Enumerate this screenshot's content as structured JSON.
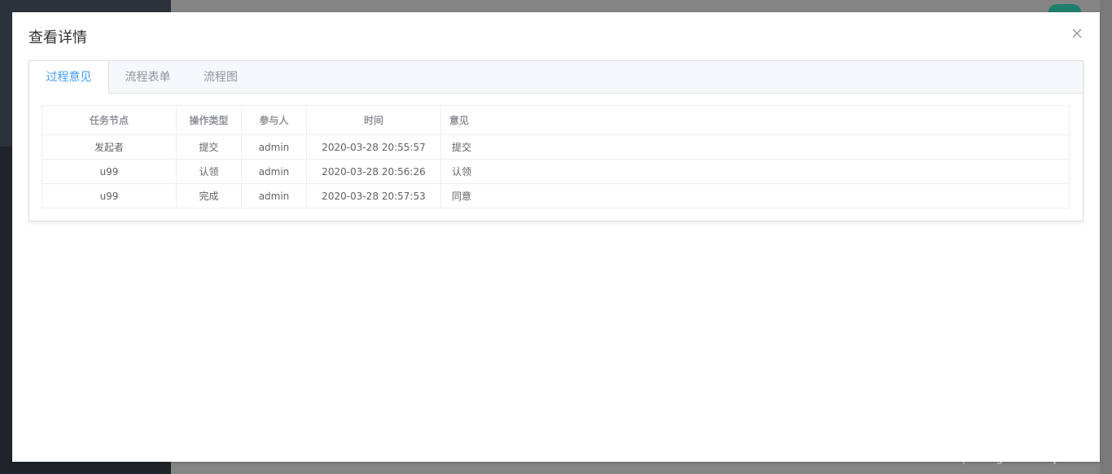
{
  "dialog": {
    "title": "查看详情"
  },
  "tabs": [
    {
      "label": "过程意见",
      "active": true
    },
    {
      "label": "流程表单",
      "active": false
    },
    {
      "label": "流程图",
      "active": false
    }
  ],
  "table": {
    "headers": [
      "任务节点",
      "操作类型",
      "参与人",
      "时间",
      "意见"
    ],
    "rows": [
      [
        "发起者",
        "提交",
        "admin",
        "2020-03-28 20:55:57",
        "提交"
      ],
      [
        "u99",
        "认领",
        "admin",
        "2020-03-28 20:56:26",
        "认领"
      ],
      [
        "u99",
        "完成",
        "admin",
        "2020-03-28 20:57:53",
        "同意"
      ]
    ]
  },
  "watermark": "https://blog.csdn.net/zjm16",
  "colors": {
    "accent": "#409eff",
    "text_primary": "#303133",
    "text_regular": "#606266",
    "text_secondary": "#909399",
    "border": "#ebeef5"
  },
  "icons": {
    "close": "close-icon"
  }
}
